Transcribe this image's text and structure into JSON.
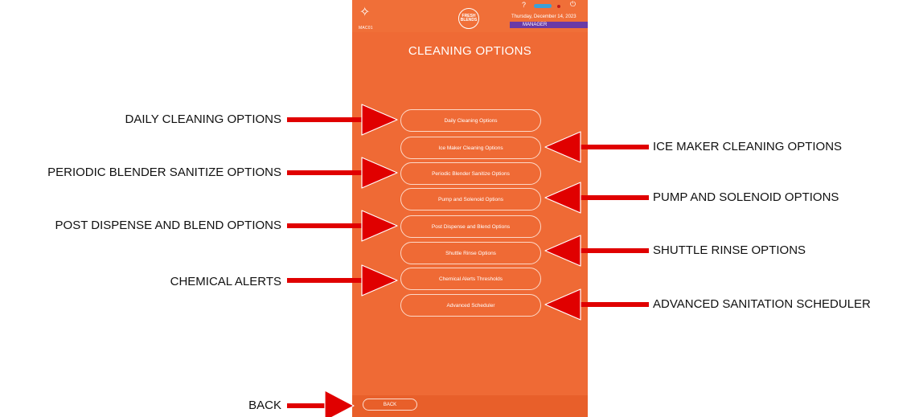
{
  "header": {
    "machine_id": "MAC01",
    "logo_text": "FRESH BLENDS",
    "help_glyph": "?",
    "date": "Thursday, December 14, 2023",
    "role": "MANAGER",
    "icons": [
      "sparkle-icon",
      "help-icon",
      "connection-toggle-icon",
      "record-icon",
      "power-icon"
    ]
  },
  "title": "CLEANING OPTIONS",
  "options": [
    "Daily Cleaning Options",
    "Ice Maker Cleaning Options",
    "Periodic Blender Sanitize Options",
    "Pump and Solenoid Options",
    "Post Dispense and Blend Options",
    "Shuttle Rinse Options",
    "Chemical Alerts Thresholds",
    "Advanced Scheduler"
  ],
  "back_label": "BACK",
  "callouts": {
    "daily": "DAILY CLEANING OPTIONS",
    "ice": "ICE MAKER CLEANING OPTIONS",
    "periodic": "PERIODIC BLENDER SANITIZE OPTIONS",
    "pump": "PUMP AND SOLENOID OPTIONS",
    "post": "POST DISPENSE AND BLEND OPTIONS",
    "shuttle": "SHUTTLE RINSE OPTIONS",
    "chemical": "CHEMICAL ALERTS",
    "advanced": "ADVANCED SANITATION SCHEDULER",
    "back": "BACK"
  },
  "colors": {
    "screen_background": "#ef6a35",
    "role_badge": "#6a3aa6",
    "annotation_arrow": "#e00000"
  }
}
